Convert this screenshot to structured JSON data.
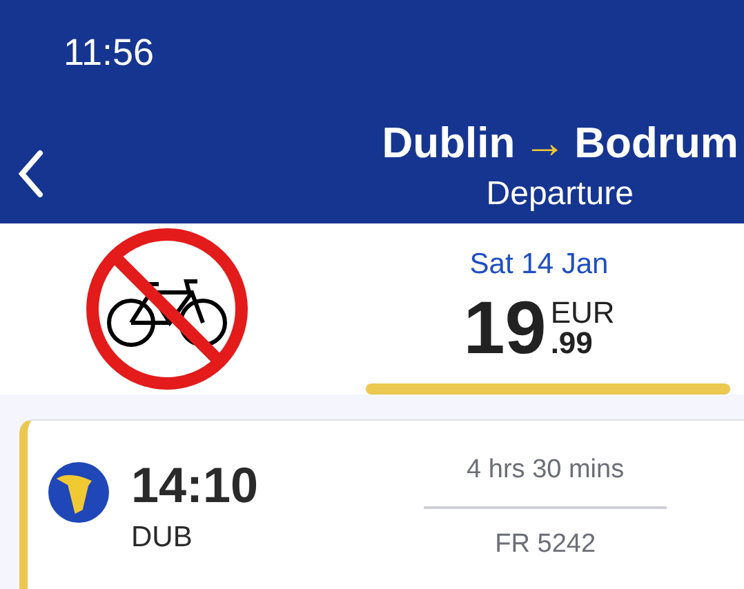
{
  "status_bar": {
    "time": "11:56"
  },
  "header": {
    "origin": "Dublin",
    "arrow": "→",
    "destination": "Bodrum",
    "subtitle": "Departure"
  },
  "date_tabs": [
    {
      "date": "Sat 14 Jan",
      "price_whole": "19",
      "price_decimal": ".99",
      "currency": "EUR",
      "selected": true
    }
  ],
  "flight": {
    "departure_time": "14:10",
    "airport": "DUB",
    "duration": "4 hrs 30 mins",
    "flight_number": "FR 5242"
  }
}
